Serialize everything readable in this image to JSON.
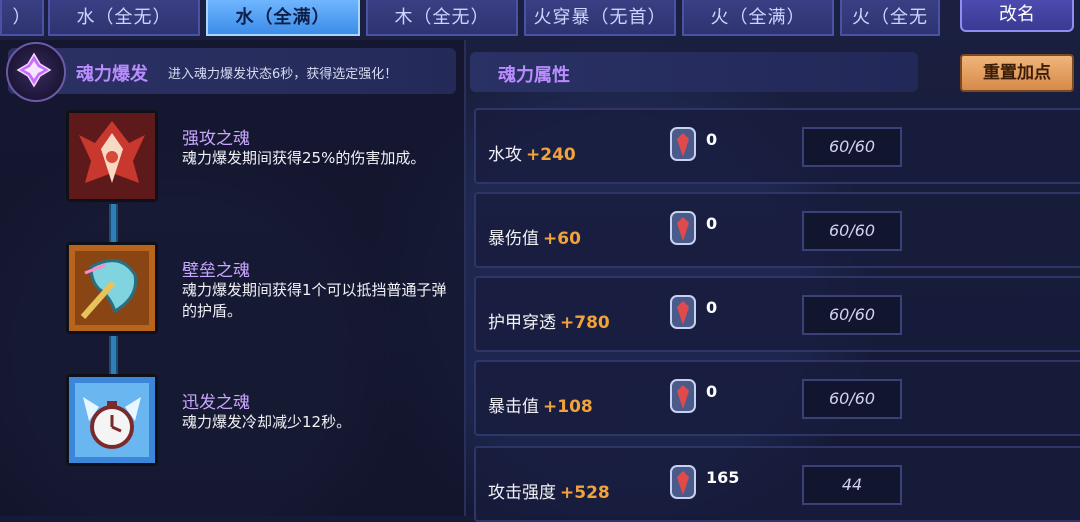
{
  "tabs": [
    {
      "label": "）"
    },
    {
      "label": "水（全无）"
    },
    {
      "label": "水（全满）",
      "active": true
    },
    {
      "label": "木（全无）"
    },
    {
      "label": "火穿暴（无首）"
    },
    {
      "label": "火（全满）"
    },
    {
      "label": "火（全无"
    }
  ],
  "rename_label": "改名",
  "burst": {
    "title": "魂力爆发",
    "description": "进入魂力爆发状态6秒，获得选定强化！"
  },
  "souls": [
    {
      "name": "强攻之魂",
      "description": "魂力爆发期间获得25%的伤害加成。",
      "icon": "attack-soul-icon"
    },
    {
      "name": "壁垒之魂",
      "description": "魂力爆发期间获得1个可以抵挡普通子弹的护盾。",
      "icon": "shield-soul-icon"
    },
    {
      "name": "迅发之魂",
      "description": "魂力爆发冷却减少12秒。",
      "icon": "clock-soul-icon"
    }
  ],
  "attributes": {
    "title": "魂力属性",
    "reset_label": "重置加点",
    "rows": [
      {
        "label": "水攻",
        "bonus": "+240",
        "count": "0",
        "value": "60/60"
      },
      {
        "label": "暴伤值",
        "bonus": "+60",
        "count": "0",
        "value": "60/60"
      },
      {
        "label": "护甲穿透",
        "bonus": "+780",
        "count": "0",
        "value": "60/60"
      },
      {
        "label": "暴击值",
        "bonus": "+108",
        "count": "0",
        "value": "60/60"
      },
      {
        "label": "攻击强度",
        "bonus": "+528",
        "count": "165",
        "value": "44"
      }
    ]
  },
  "colors": {
    "accent_purple": "#b98cff",
    "bonus_orange": "#f2a23a",
    "active_tab": "#4fa3f7"
  }
}
